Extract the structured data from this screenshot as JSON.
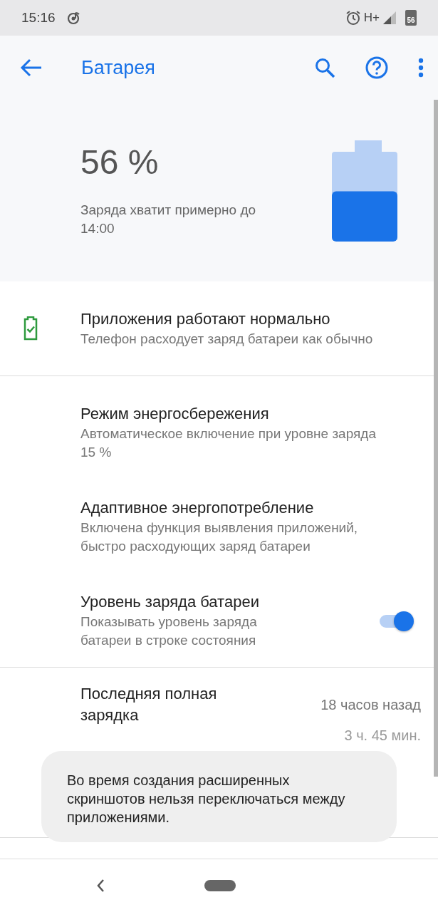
{
  "status_bar": {
    "time": "15:16",
    "network": "H+",
    "battery": "56"
  },
  "app_bar": {
    "title": "Батарея"
  },
  "summary": {
    "percent": "56 %",
    "estimate": "Заряда хватит примерно до 14:00",
    "level": 0.56
  },
  "items": [
    {
      "kind": "status",
      "title": "Приложения работают нормально",
      "subtitle": "Телефон расходует заряд батареи как обычно",
      "divider_after": true
    },
    {
      "kind": "plain",
      "title": "Режим энергосбережения",
      "subtitle": "Автоматическое включение при уровне заряда 15 %"
    },
    {
      "kind": "plain",
      "title": "Адаптивное энергопотребление",
      "subtitle": "Включена функция выявления приложений, быстро расходующих заряд батареи"
    },
    {
      "kind": "toggle",
      "title": "Уровень заряда батареи",
      "subtitle": "Показывать уровень заряда батареи в строке состояния",
      "on": true,
      "divider_after": true
    },
    {
      "kind": "value",
      "title": "Последняя полная зарядка",
      "value": "18 часов назад"
    },
    {
      "kind": "value_hidden",
      "value": "3 ч. 45 мин.",
      "divider_after": true
    }
  ],
  "toast": {
    "text": "Во время создания расширенных скриншотов нельзя переключаться между приложениями."
  }
}
